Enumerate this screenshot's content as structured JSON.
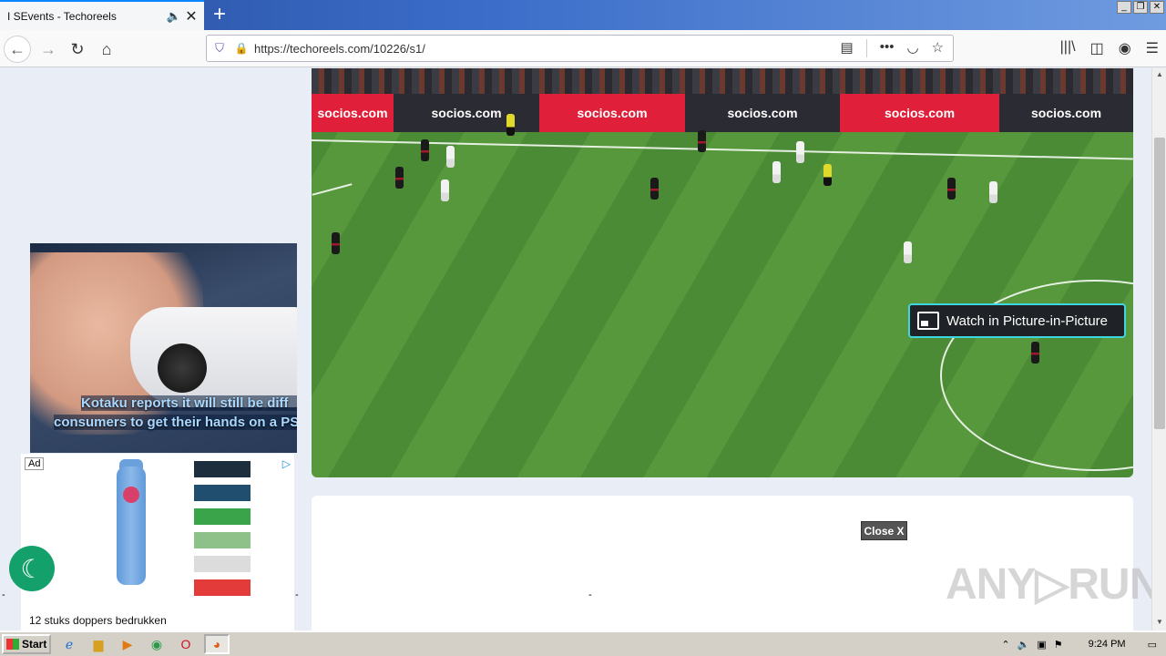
{
  "browser": {
    "tab_title": "I SEvents - Techoreels",
    "tab_audio_icon": "speaker-icon",
    "tab_close": "✕",
    "new_tab": "+",
    "url": "https://techoreels.com/10226/s1/",
    "window_buttons": [
      "_",
      "❐",
      "✕"
    ]
  },
  "video": {
    "pip_label": "Watch in Picture-in-Picture",
    "ad_boards": [
      "socios.com",
      "socios.com",
      "socios.com",
      "socios.com",
      "socios.com",
      "socios.com"
    ]
  },
  "left_ad_video": {
    "caption_line1": "Kotaku reports it will still be diff",
    "caption_line2": "consumers to get their hands on a PS"
  },
  "ad_banner": {
    "ad_label": "Ad",
    "adchoices": "▷",
    "title": "12 stuks doppers bedrukken",
    "swatch_colors": [
      "#1d2e3e",
      "#1f4e6e",
      "#3aa44a",
      "#8ec08a",
      "#dcdcdc",
      "#e33a3a"
    ]
  },
  "page": {
    "close_button": "Close X",
    "dash_1": "-",
    "dash_2": "-",
    "dash_3": "-",
    "watermark": "ANY▷RUN"
  },
  "taskbar": {
    "start_label": "Start",
    "clock": "9:24 PM"
  }
}
